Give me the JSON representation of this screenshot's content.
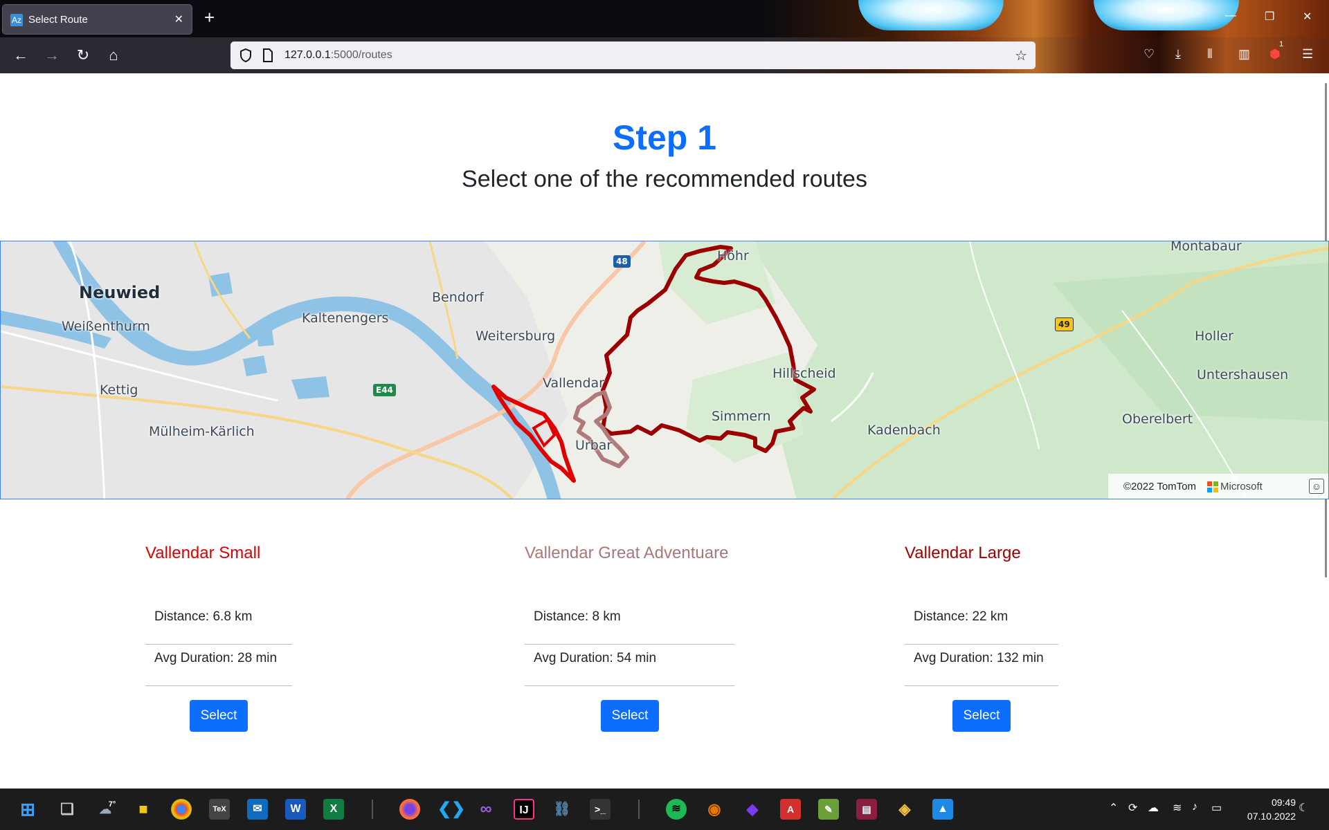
{
  "browser": {
    "tab_title": "Select Route",
    "tab_favicon": "Az",
    "url_host": "127.0.0.1",
    "url_rest": ":5000/routes",
    "notification_count": "1"
  },
  "page": {
    "step_title": "Step 1",
    "subtitle": "Select one of the recommended routes"
  },
  "map": {
    "labels": {
      "neuwied": "Neuwied",
      "weissenthurm": "Weißenthurm",
      "kaltenengers": "Kaltenengers",
      "bendorf": "Bendorf",
      "weitersburg": "Weitersburg",
      "vallendar": "Vallendar",
      "hoehr": "Höhr",
      "hillscheid": "Hillscheid",
      "simmern": "Simmern",
      "kettig": "Kettig",
      "muelheim": "Mülheim-Kärlich",
      "urbar": "Urbar",
      "kadenbach": "Kadenbach",
      "montabaur": "Montabaur",
      "holler": "Holler",
      "untershausen": "Untershausen",
      "oberelbert": "Oberelbert"
    },
    "shields": {
      "a48": "48",
      "a49": "49",
      "e44": "E44"
    },
    "attribution_tomtom": "©2022 TomTom",
    "attribution_microsoft": "Microsoft",
    "route_colors": {
      "small": "#e00000",
      "great": "#b07a7a",
      "large": "#9b0000"
    }
  },
  "routes": [
    {
      "name": "Vallendar Small",
      "distance": "Distance: 6.8 km",
      "duration": "Avg Duration: 28 min",
      "button": "Select",
      "color": "#dc0000"
    },
    {
      "name": "Vallendar Great Adventuare",
      "distance": "Distance: 8 km",
      "duration": "Avg Duration: 54 min",
      "button": "Select",
      "color": "#a87878"
    },
    {
      "name": "Vallendar Large",
      "distance": "Distance: 22 km",
      "duration": "Avg Duration: 132 min",
      "button": "Select",
      "color": "#a00000"
    }
  ],
  "taskbar": {
    "weather": "7°",
    "time": "09:49",
    "date": "07.10.2022"
  }
}
